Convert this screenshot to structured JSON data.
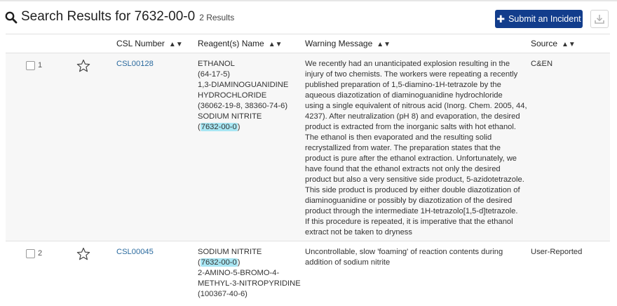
{
  "header": {
    "title": "Search Results for 7632-00-0",
    "result_count": "2 Results",
    "submit_label": "Submit an Incident",
    "submit_icon": "plus-icon",
    "download_icon": "download-icon",
    "accent_color": "#123d8c"
  },
  "table": {
    "columns": [
      "CSL Number",
      "Reagent(s) Name",
      "Warning Message",
      "Source"
    ],
    "rows": [
      {
        "index": "1",
        "csl": "CSL00128",
        "reagents": {
          "before": [
            "ETHANOL",
            "(64-17-5)",
            "1,3-DIAMINOGUANIDINE",
            "HYDROCHLORIDE",
            "(36062-19-8, 38360-74-6)",
            "SODIUM NITRITE"
          ],
          "open": "(",
          "highlight": "7632-00-0",
          "close": ")",
          "after": []
        },
        "warning_lines": [
          "We recently had an unanticipated explosion resulting in the",
          "injury of two chemists. The workers were repeating a recently",
          "published preparation of 1,5-diamino-1H-tetrazole by the",
          "aqueous diazotization of diaminoguanidine hydrochloride",
          "using a single equivalent of nitrous acid (Inorg. Chem. 2005, 44,",
          "4237). After neutralization (pH 8) and evaporation, the desired",
          "product is extracted from the inorganic salts with hot ethanol.",
          "The ethanol is then evaporated and the resulting solid",
          "recrystallized from water. The preparation states that the",
          "product is pure after the ethanol extraction. Unfortunately, we",
          "have found that the ethanol extracts not only the desired",
          "product but also a very sensitive side product, 5-azidotetrazole.",
          "This side product is produced by either double diazotization of",
          "diaminoguanidine or possibly by diazotization of the desired",
          "product through the intermediate 1H-tetrazolo[1,5-d]tetrazole.",
          "If this procedure is repeated, it is imperative that the ethanol",
          "extract not be taken to dryness"
        ],
        "source": "C&EN"
      },
      {
        "index": "2",
        "csl": "CSL00045",
        "reagents": {
          "before": [
            "SODIUM NITRITE"
          ],
          "open": "(",
          "highlight": "7632-00-0",
          "close": ")",
          "after": [
            "2-AMINO-5-BROMO-4-",
            "METHYL-3-NITROPYRIDINE",
            "(100367-40-6)"
          ]
        },
        "warning_lines": [
          "Uncontrollable, slow 'foaming' of reaction contents during",
          "addition of sodium nitrite"
        ],
        "source": "User-Reported"
      }
    ]
  }
}
